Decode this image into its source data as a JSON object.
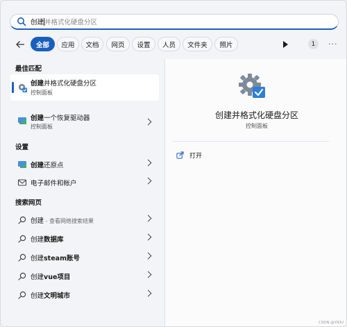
{
  "search": {
    "typed": "创建",
    "suggestion_rest": "并格式化硬盘分区"
  },
  "filters": {
    "tabs": [
      "全部",
      "应用",
      "文档",
      "网页",
      "设置",
      "人员",
      "文件夹",
      "照片"
    ],
    "active": "全部",
    "count": "1",
    "more": "···"
  },
  "left": {
    "best_match_heading": "最佳匹配",
    "best_match": {
      "title_bold": "创建",
      "title_rest": "并格式化硬盘分区",
      "subtitle": "控制面板"
    },
    "item2": {
      "title_bold": "创建",
      "title_rest": "一个恢复驱动器",
      "subtitle": "控制面板"
    },
    "settings_heading": "设置",
    "settings_items": [
      {
        "bold": "创建",
        "rest": "还原点"
      },
      {
        "bold": "",
        "rest": "电子邮件和帐户"
      }
    ],
    "web_heading": "搜索网页",
    "web_items": [
      {
        "bold": "",
        "rest": "创建",
        "hint": " - 查看网络搜索结果"
      },
      {
        "bold": "数据库",
        "rest": "创建",
        "hint": ""
      },
      {
        "bold": "steam账号",
        "rest": "创建",
        "hint": ""
      },
      {
        "bold": "vue项目",
        "rest": "创建",
        "hint": ""
      },
      {
        "bold": "文明城市",
        "rest": "创建",
        "hint": ""
      }
    ]
  },
  "right": {
    "title": "创建并格式化硬盘分区",
    "subtitle": "控制面板",
    "open_label": "打开",
    "watermark": "CSDN @YIDU"
  },
  "colors": {
    "accent": "#1a5fc0",
    "panel": "#fbfbfc",
    "background": "#f2f4f7"
  }
}
